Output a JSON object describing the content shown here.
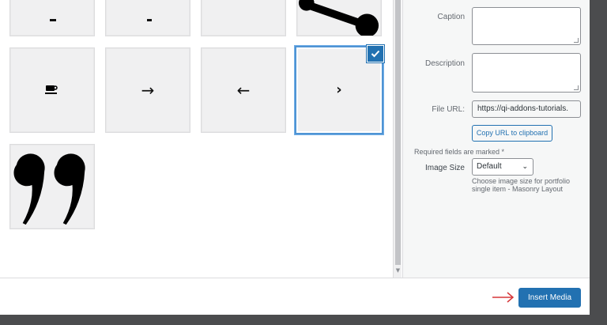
{
  "grid": {
    "tiles": [
      {
        "icon": "partial-icon",
        "glyph": ""
      },
      {
        "icon": "partial-icon",
        "glyph": ""
      },
      {
        "icon": "partial-icon",
        "glyph": ""
      },
      {
        "icon": "share-nodes-icon",
        "glyph": ""
      },
      {
        "icon": "coffee-cup-icon",
        "glyph": ""
      },
      {
        "icon": "arrow-right-icon",
        "glyph": "→"
      },
      {
        "icon": "arrow-left-icon",
        "glyph": "←"
      },
      {
        "icon": "chevron-right-icon",
        "glyph": "›"
      },
      {
        "icon": "quote-icon",
        "glyph": ""
      }
    ]
  },
  "sidebar": {
    "caption_label": "Caption",
    "description_label": "Description",
    "file_url_label": "File URL:",
    "file_url_value": "https://qi-addons-tutorials.",
    "copy_button": "Copy URL to clipboard",
    "required_note": "Required fields are marked *",
    "image_size_label": "Image Size",
    "image_size_value": "Default",
    "image_size_help": "Choose image size for portfolio single item - Masonry Layout"
  },
  "toolbar": {
    "insert_button": "Insert Media"
  },
  "colors": {
    "accent": "#2271b1",
    "arrow": "#d63638"
  }
}
